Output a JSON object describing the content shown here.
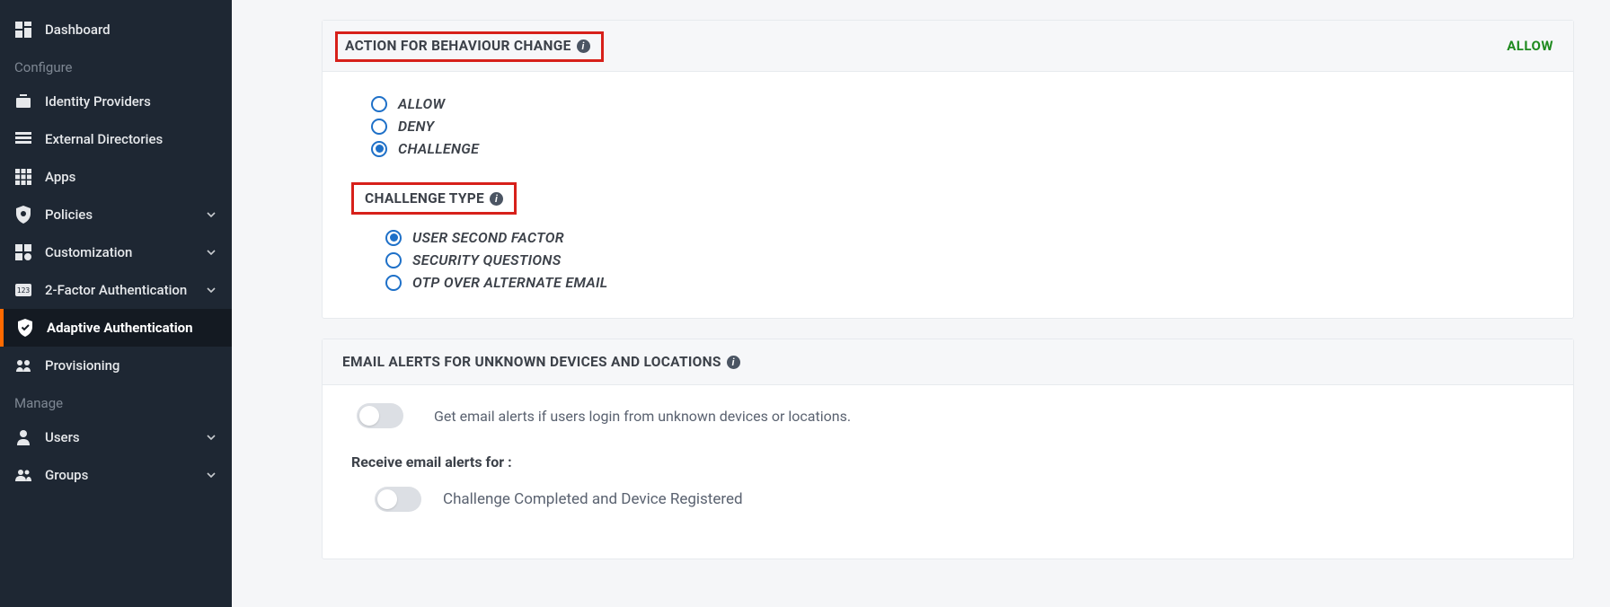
{
  "sidebar": {
    "items": [
      {
        "label": "Dashboard"
      }
    ],
    "configure_label": "Configure",
    "configure_items": [
      {
        "label": "Identity Providers"
      },
      {
        "label": "External Directories"
      },
      {
        "label": "Apps"
      },
      {
        "label": "Policies",
        "expandable": true
      },
      {
        "label": "Customization",
        "expandable": true
      },
      {
        "label": "2-Factor Authentication",
        "expandable": true
      },
      {
        "label": "Adaptive Authentication",
        "active": true
      },
      {
        "label": "Provisioning"
      }
    ],
    "manage_label": "Manage",
    "manage_items": [
      {
        "label": "Users",
        "expandable": true
      },
      {
        "label": "Groups",
        "expandable": true
      }
    ]
  },
  "panel1": {
    "title": "ACTION FOR BEHAVIOUR CHANGE",
    "status": "ALLOW",
    "options": [
      {
        "label": "ALLOW"
      },
      {
        "label": "DENY"
      },
      {
        "label": "CHALLENGE",
        "selected": true
      }
    ],
    "challenge_title": "CHALLENGE TYPE",
    "challenge_options": [
      {
        "label": "USER SECOND FACTOR",
        "selected": true
      },
      {
        "label": "SECURITY QUESTIONS"
      },
      {
        "label": "OTP OVER ALTERNATE EMAIL"
      }
    ]
  },
  "panel2": {
    "title": "EMAIL ALERTS FOR UNKNOWN DEVICES AND LOCATIONS",
    "toggle_text": "Get email alerts if users login from unknown devices or locations.",
    "sub_heading": "Receive email alerts for :",
    "toggle2_text": "Challenge Completed and Device Registered"
  }
}
